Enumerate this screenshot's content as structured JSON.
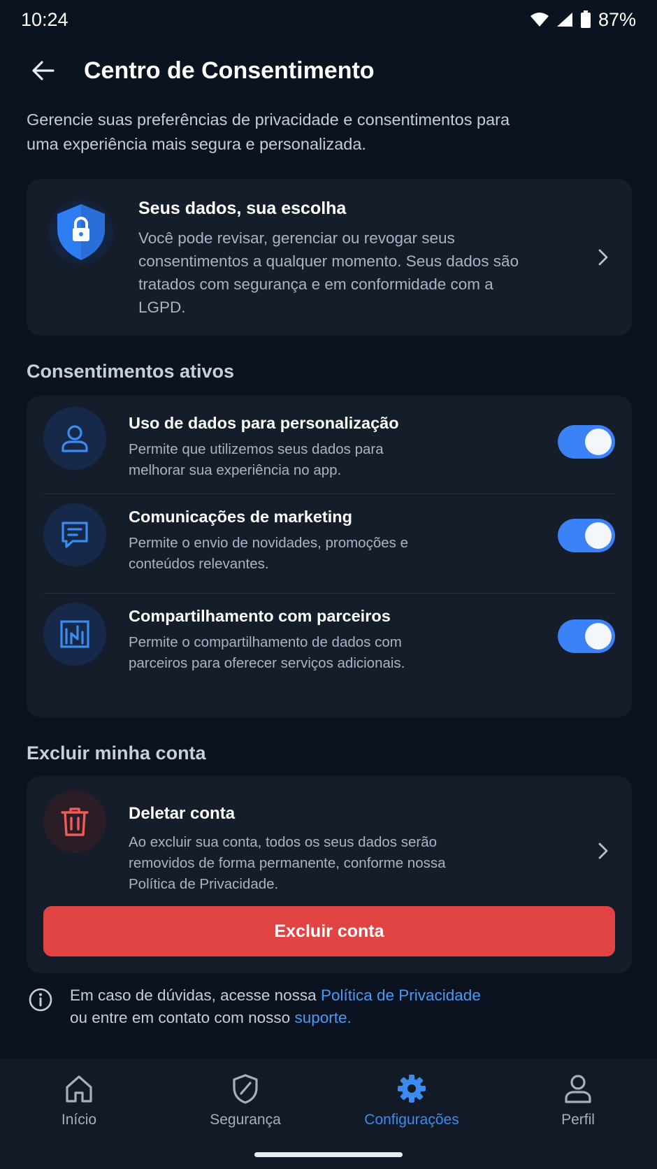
{
  "status_bar": {
    "time": "10:24",
    "battery_percent": "87%",
    "icons": [
      "wifi-icon",
      "signal-icon",
      "battery-icon"
    ]
  },
  "header": {
    "title": "Centro de Consentimento",
    "back_icon": "back-arrow-icon"
  },
  "intro": "Gerencie suas preferências de privacidade e consentimentos para uma experiência mais segura e personalizada.",
  "info_card": {
    "title": "Seus dados, sua escolha",
    "body": "Você pode revisar, gerenciar ou revogar seus consentimentos a qualquer momento. Seus dados são tratados com segurança e em conformidade com a LGPD.",
    "icon": "shield-lock-icon"
  },
  "consents": {
    "section_title": "Consentimentos ativos",
    "items": [
      {
        "title": "Uso de dados para personalização",
        "description": "Permite que utilizemos seus dados para melhorar sua experiência no app.",
        "icon": "user-icon",
        "enabled": true
      },
      {
        "title": "Comunicações de marketing",
        "description": "Permite o envio de novidades, promoções e conteúdos relevantes.",
        "icon": "message-icon",
        "enabled": true
      },
      {
        "title": "Compartilhamento com parceiros",
        "description": "Permite o compartilhamento de dados com parceiros para oferecer serviços adicionais.",
        "icon": "chart-icon",
        "enabled": true
      }
    ]
  },
  "delete": {
    "section_title": "Excluir minha conta",
    "title": "Deletar conta",
    "description": "Ao excluir sua conta, todos os seus dados serão removidos de forma permanente, conforme nossa Política de Privacidade.",
    "button_label": "Excluir conta",
    "icon": "trash-icon"
  },
  "help": {
    "line1_prefix": "Em caso de dúvidas, acesse nossa ",
    "privacy_link": "Política de Privacidade",
    "line2_prefix": "ou entre em contato com nosso ",
    "support_link": "suporte",
    "line2_suffix": ".",
    "icon": "info-icon"
  },
  "bottom_nav": {
    "items": [
      {
        "label": "Início",
        "icon": "home-icon",
        "active": false
      },
      {
        "label": "Segurança",
        "icon": "shield-icon",
        "active": false
      },
      {
        "label": "Configurações",
        "icon": "gear-icon",
        "active": true
      },
      {
        "label": "Perfil",
        "icon": "person-icon",
        "active": false
      }
    ]
  },
  "colors": {
    "background": "#0c1320",
    "card": "#151d2b",
    "accent": "#3b82f6",
    "link": "#4a9af5",
    "danger": "#e24343"
  }
}
